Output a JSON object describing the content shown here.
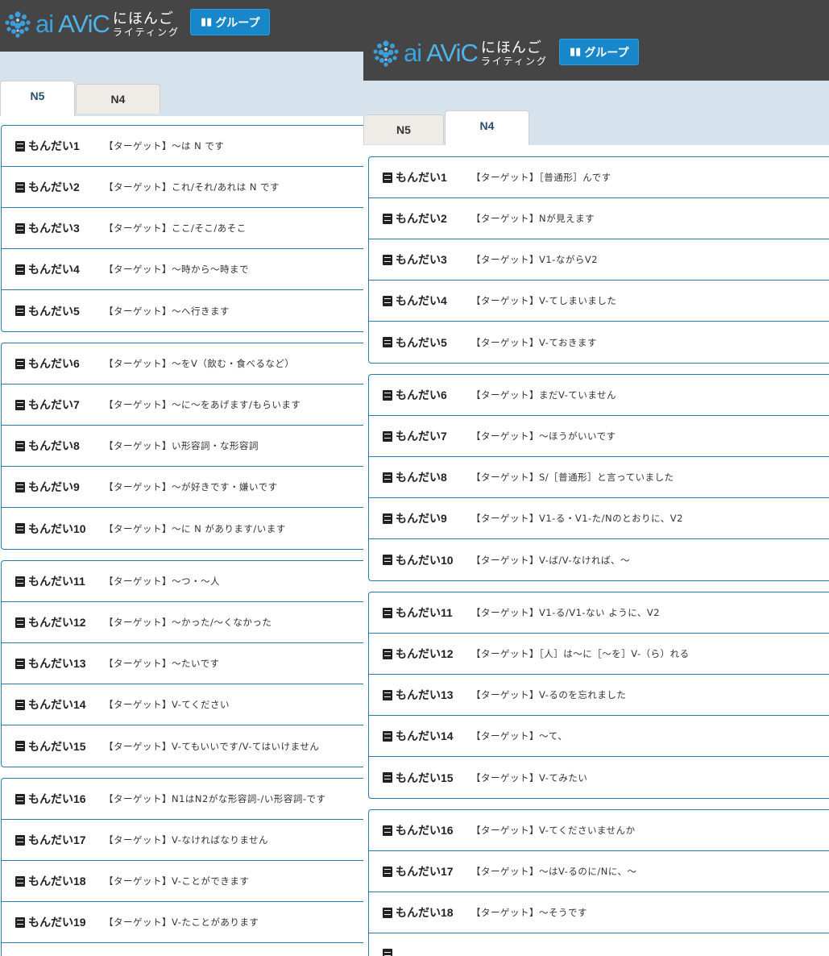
{
  "brand": {
    "ai": "ai",
    "avic": "AViC",
    "jp_line1": "にほんご",
    "jp_line2": "ライティング"
  },
  "group_button": {
    "label": "グループ"
  },
  "tabs": {
    "n5": "N5",
    "n4": "N4"
  },
  "n5": {
    "groups": [
      [
        {
          "title": "もんだい1",
          "target": "【ターゲット】～は N です"
        },
        {
          "title": "もんだい2",
          "target": "【ターゲット】これ/それ/あれは N です"
        },
        {
          "title": "もんだい3",
          "target": "【ターゲット】ここ/そこ/あそこ"
        },
        {
          "title": "もんだい4",
          "target": "【ターゲット】～時から～時まで"
        },
        {
          "title": "もんだい5",
          "target": "【ターゲット】～へ行きます"
        }
      ],
      [
        {
          "title": "もんだい6",
          "target": "【ターゲット】～をV（飲む・食べるなど）"
        },
        {
          "title": "もんだい7",
          "target": "【ターゲット】～に～をあげます/もらいます"
        },
        {
          "title": "もんだい8",
          "target": "【ターゲット】い形容詞・な形容詞"
        },
        {
          "title": "もんだい9",
          "target": "【ターゲット】～が好きです・嫌いです"
        },
        {
          "title": "もんだい10",
          "target": "【ターゲット】～に N があります/います"
        }
      ],
      [
        {
          "title": "もんだい11",
          "target": "【ターゲット】～つ・～人"
        },
        {
          "title": "もんだい12",
          "target": "【ターゲット】～かった/～くなかった"
        },
        {
          "title": "もんだい13",
          "target": "【ターゲット】～たいです"
        },
        {
          "title": "もんだい14",
          "target": "【ターゲット】V-てください"
        },
        {
          "title": "もんだい15",
          "target": "【ターゲット】V-てもいいです/V-てはいけません"
        }
      ],
      [
        {
          "title": "もんだい16",
          "target": "【ターゲット】N1はN2がな形容詞-/い形容詞-です"
        },
        {
          "title": "もんだい17",
          "target": "【ターゲット】V-なければなりません"
        },
        {
          "title": "もんだい18",
          "target": "【ターゲット】V-ことができます"
        },
        {
          "title": "もんだい19",
          "target": "【ターゲット】V-たことがあります"
        },
        {
          "title": "",
          "target": ""
        }
      ]
    ]
  },
  "n4": {
    "groups": [
      [
        {
          "title": "もんだい1",
          "target": "【ターゲット】［普通形］んです"
        },
        {
          "title": "もんだい2",
          "target": "【ターゲット】Nが見えます"
        },
        {
          "title": "もんだい3",
          "target": "【ターゲット】V1-ながらV2"
        },
        {
          "title": "もんだい4",
          "target": "【ターゲット】V-てしまいました"
        },
        {
          "title": "もんだい5",
          "target": "【ターゲット】V-ておきます"
        }
      ],
      [
        {
          "title": "もんだい6",
          "target": "【ターゲット】まだV-ていません"
        },
        {
          "title": "もんだい7",
          "target": "【ターゲット】～ほうがいいです"
        },
        {
          "title": "もんだい8",
          "target": "【ターゲット】S/［普通形］と言っていました"
        },
        {
          "title": "もんだい9",
          "target": "【ターゲット】V1-る・V1-た/Nのとおりに、V2"
        },
        {
          "title": "もんだい10",
          "target": "【ターゲット】V-ば/V-なければ、～"
        }
      ],
      [
        {
          "title": "もんだい11",
          "target": "【ターゲット】V1-る/V1-ない ように、V2"
        },
        {
          "title": "もんだい12",
          "target": "【ターゲット】［人］は～に［～を］V-（ら）れる"
        },
        {
          "title": "もんだい13",
          "target": "【ターゲット】V-るのを忘れました"
        },
        {
          "title": "もんだい14",
          "target": "【ターゲット】～て、"
        },
        {
          "title": "もんだい15",
          "target": "【ターゲット】V-てみたい"
        }
      ],
      [
        {
          "title": "もんだい16",
          "target": "【ターゲット】V-てくださいませんか"
        },
        {
          "title": "もんだい17",
          "target": "【ターゲット】～はV-るのに/Nに、～"
        },
        {
          "title": "もんだい18",
          "target": "【ターゲット】～そうです"
        },
        {
          "title": "",
          "target": ""
        }
      ]
    ]
  }
}
